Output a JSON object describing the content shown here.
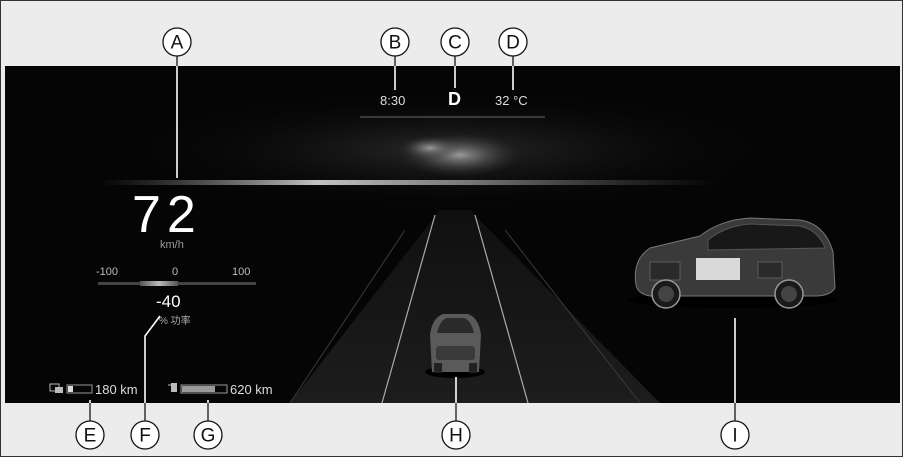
{
  "callouts": [
    "A",
    "B",
    "C",
    "D",
    "E",
    "F",
    "G",
    "H",
    "I"
  ],
  "status": {
    "time": "8:30",
    "gear": "D",
    "temperature": "32 °C"
  },
  "speed": {
    "value": "72",
    "unit": "km/h"
  },
  "power": {
    "scale_min": "-100",
    "scale_mid": "0",
    "scale_max": "100",
    "value": "-40",
    "label": "% 功率"
  },
  "range": {
    "electric": "180 km",
    "fuel": "620 km"
  },
  "colors": {
    "frame": "#ececec",
    "screen": "#050505",
    "text": "#ffffff",
    "muted": "#9a9a9a"
  }
}
